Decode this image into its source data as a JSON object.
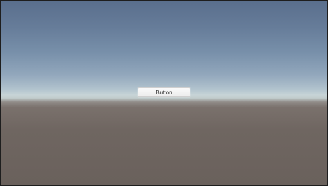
{
  "scene": {
    "colors": {
      "sky_top": "#5a6f8d",
      "horizon": "#c4d2d6",
      "ground": "#6a615c",
      "frame": "#1e1e1e"
    }
  },
  "button": {
    "label": "Button"
  }
}
